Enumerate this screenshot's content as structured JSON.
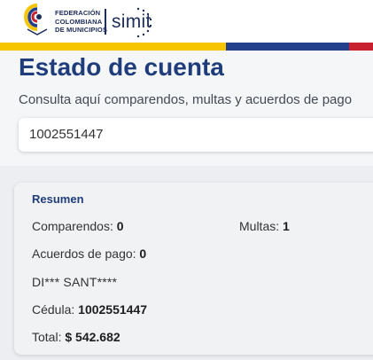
{
  "header": {
    "org_lines": [
      "FEDERACIÓN",
      "COLOMBIANA",
      "DE MUNICIPIOS"
    ],
    "brand": "simit",
    "colors": {
      "navy": "#1c2c5b",
      "yellow": "#f7c500",
      "blue": "#22408c",
      "red": "#c8202f"
    }
  },
  "page": {
    "title": "Estado de cuenta",
    "subtitle": "Consulta aquí comparendos, multas y acuerdos de pago"
  },
  "search": {
    "value": "1002551447"
  },
  "summary": {
    "title": "Resumen",
    "comparendos_label": "Comparendos:",
    "comparendos_value": "0",
    "multas_label": "Multas:",
    "multas_value": "1",
    "acuerdos_label": "Acuerdos de pago:",
    "acuerdos_value": "0",
    "name": "DI*** SANT****",
    "cedula_label": "Cédula:",
    "cedula_value": "1002551447",
    "total_label": "Total:",
    "total_value": "$ 542.682"
  }
}
